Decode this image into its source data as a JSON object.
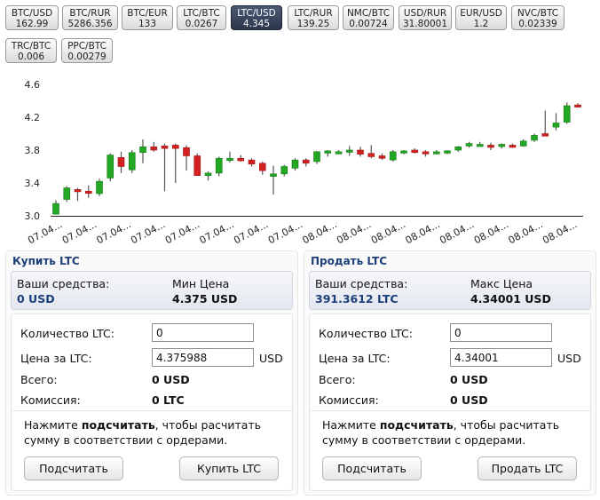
{
  "pairs": [
    {
      "name": "BTC/USD",
      "value": "162.99",
      "active": false
    },
    {
      "name": "BTC/RUR",
      "value": "5286.356",
      "active": false
    },
    {
      "name": "BTC/EUR",
      "value": "133",
      "active": false
    },
    {
      "name": "LTC/BTC",
      "value": "0.0267",
      "active": false
    },
    {
      "name": "LTC/USD",
      "value": "4.345",
      "active": true
    },
    {
      "name": "LTC/RUR",
      "value": "139.25",
      "active": false
    },
    {
      "name": "NMC/BTC",
      "value": "0.00724",
      "active": false
    },
    {
      "name": "USD/RUR",
      "value": "31.80001",
      "active": false
    },
    {
      "name": "EUR/USD",
      "value": "1.2",
      "active": false
    },
    {
      "name": "NVC/BTC",
      "value": "0.02339",
      "active": false
    },
    {
      "name": "TRC/BTC",
      "value": "0.006",
      "active": false
    },
    {
      "name": "PPC/BTC",
      "value": "0.00279",
      "active": false
    }
  ],
  "chart_data": {
    "type": "candlestick",
    "y_ticks": [
      "4.6",
      "4.2",
      "3.8",
      "3.4",
      "3.0"
    ],
    "ylim": [
      3.0,
      4.6
    ],
    "x_labels": [
      "07.04...",
      "07.04...",
      "07.04...",
      "07.04...",
      "07.04...",
      "07.04...",
      "07.04...",
      "07.04...",
      "08.04...",
      "08.04...",
      "08.04...",
      "08.04...",
      "08.04...",
      "08.04...",
      "08.04...",
      "08.04..."
    ],
    "colors": {
      "up": "#22a822",
      "down": "#d42020"
    },
    "candles": [
      {
        "o": 3.02,
        "h": 3.19,
        "l": 3.02,
        "c": 3.15
      },
      {
        "o": 3.2,
        "h": 3.36,
        "l": 3.17,
        "c": 3.34
      },
      {
        "o": 3.32,
        "h": 3.34,
        "l": 3.18,
        "c": 3.3
      },
      {
        "o": 3.3,
        "h": 3.37,
        "l": 3.22,
        "c": 3.28
      },
      {
        "o": 3.27,
        "h": 3.45,
        "l": 3.24,
        "c": 3.42
      },
      {
        "o": 3.46,
        "h": 3.76,
        "l": 3.42,
        "c": 3.74
      },
      {
        "o": 3.71,
        "h": 3.78,
        "l": 3.52,
        "c": 3.6
      },
      {
        "o": 3.56,
        "h": 3.8,
        "l": 3.52,
        "c": 3.77
      },
      {
        "o": 3.77,
        "h": 3.93,
        "l": 3.64,
        "c": 3.84
      },
      {
        "o": 3.84,
        "h": 3.9,
        "l": 3.78,
        "c": 3.8
      },
      {
        "o": 3.85,
        "h": 3.88,
        "l": 3.3,
        "c": 3.82
      },
      {
        "o": 3.86,
        "h": 3.88,
        "l": 3.4,
        "c": 3.82
      },
      {
        "o": 3.83,
        "h": 3.86,
        "l": 3.55,
        "c": 3.73
      },
      {
        "o": 3.73,
        "h": 3.76,
        "l": 3.5,
        "c": 3.49
      },
      {
        "o": 3.49,
        "h": 3.54,
        "l": 3.43,
        "c": 3.52
      },
      {
        "o": 3.52,
        "h": 3.72,
        "l": 3.48,
        "c": 3.7
      },
      {
        "o": 3.68,
        "h": 3.78,
        "l": 3.65,
        "c": 3.7
      },
      {
        "o": 3.7,
        "h": 3.74,
        "l": 3.66,
        "c": 3.67
      },
      {
        "o": 3.68,
        "h": 3.7,
        "l": 3.6,
        "c": 3.63
      },
      {
        "o": 3.64,
        "h": 3.66,
        "l": 3.5,
        "c": 3.55
      },
      {
        "o": 3.48,
        "h": 3.61,
        "l": 3.26,
        "c": 3.51
      },
      {
        "o": 3.51,
        "h": 3.62,
        "l": 3.48,
        "c": 3.6
      },
      {
        "o": 3.58,
        "h": 3.7,
        "l": 3.55,
        "c": 3.68
      },
      {
        "o": 3.68,
        "h": 3.7,
        "l": 3.6,
        "c": 3.64
      },
      {
        "o": 3.66,
        "h": 3.79,
        "l": 3.63,
        "c": 3.78
      },
      {
        "o": 3.77,
        "h": 3.8,
        "l": 3.72,
        "c": 3.79
      },
      {
        "o": 3.78,
        "h": 3.8,
        "l": 3.75,
        "c": 3.78
      },
      {
        "o": 3.78,
        "h": 3.85,
        "l": 3.73,
        "c": 3.8
      },
      {
        "o": 3.8,
        "h": 3.84,
        "l": 3.72,
        "c": 3.75
      },
      {
        "o": 3.76,
        "h": 3.86,
        "l": 3.7,
        "c": 3.72
      },
      {
        "o": 3.73,
        "h": 3.76,
        "l": 3.68,
        "c": 3.7
      },
      {
        "o": 3.68,
        "h": 3.8,
        "l": 3.66,
        "c": 3.78
      },
      {
        "o": 3.77,
        "h": 3.8,
        "l": 3.75,
        "c": 3.79
      },
      {
        "o": 3.8,
        "h": 3.82,
        "l": 3.76,
        "c": 3.77
      },
      {
        "o": 3.78,
        "h": 3.8,
        "l": 3.72,
        "c": 3.76
      },
      {
        "o": 3.77,
        "h": 3.8,
        "l": 3.75,
        "c": 3.78
      },
      {
        "o": 3.77,
        "h": 3.8,
        "l": 3.75,
        "c": 3.79
      },
      {
        "o": 3.8,
        "h": 3.85,
        "l": 3.78,
        "c": 3.84
      },
      {
        "o": 3.85,
        "h": 3.9,
        "l": 3.83,
        "c": 3.88
      },
      {
        "o": 3.86,
        "h": 3.9,
        "l": 3.84,
        "c": 3.87
      },
      {
        "o": 3.86,
        "h": 3.89,
        "l": 3.8,
        "c": 3.84
      },
      {
        "o": 3.85,
        "h": 3.88,
        "l": 3.82,
        "c": 3.87
      },
      {
        "o": 3.86,
        "h": 3.88,
        "l": 3.83,
        "c": 3.85
      },
      {
        "o": 3.85,
        "h": 3.93,
        "l": 3.84,
        "c": 3.91
      },
      {
        "o": 3.92,
        "h": 4.0,
        "l": 3.9,
        "c": 3.98
      },
      {
        "o": 4.0,
        "h": 4.28,
        "l": 3.97,
        "c": 3.97
      },
      {
        "o": 4.08,
        "h": 4.25,
        "l": 4.04,
        "c": 4.13
      },
      {
        "o": 4.14,
        "h": 4.38,
        "l": 4.12,
        "c": 4.34
      },
      {
        "o": 4.35,
        "h": 4.37,
        "l": 4.32,
        "c": 4.34
      }
    ]
  },
  "buy": {
    "title": "Купить LTC",
    "funds_label": "Ваши средства:",
    "funds_value": "0 USD",
    "price_label": "Мин Цена",
    "price_value": "4.375 USD",
    "qty_label": "Количество LTC:",
    "qty_value": "0",
    "price_per_label": "Цена за LTC:",
    "price_per_value": "4.375988",
    "unit": "USD",
    "total_label": "Всего:",
    "total_value": "0 USD",
    "fee_label": "Комиссия:",
    "fee_value": "0 LTC",
    "hint_pre": "Нажмите ",
    "hint_bold": "подсчитать",
    "hint_post": ", чтобы расчитать сумму в соответствии с ордерами.",
    "calc_label": "Подсчитать",
    "action_label": "Купить LTC"
  },
  "sell": {
    "title": "Продать LTC",
    "funds_label": "Ваши средства:",
    "funds_value": "391.3612 LTC",
    "price_label": "Макс Цена",
    "price_value": "4.34001 USD",
    "qty_label": "Количество LTC:",
    "qty_value": "0",
    "price_per_label": "Цена за LTC:",
    "price_per_value": "4.34001",
    "unit": "USD",
    "total_label": "Всего:",
    "total_value": "0 USD",
    "fee_label": "Комиссия:",
    "fee_value": "0 USD",
    "hint_pre": "Нажмите ",
    "hint_bold": "подсчитать",
    "hint_post": ", чтобы расчитать сумму в соответствии с ордерами.",
    "calc_label": "Подсчитать",
    "action_label": "Продать LTC"
  }
}
